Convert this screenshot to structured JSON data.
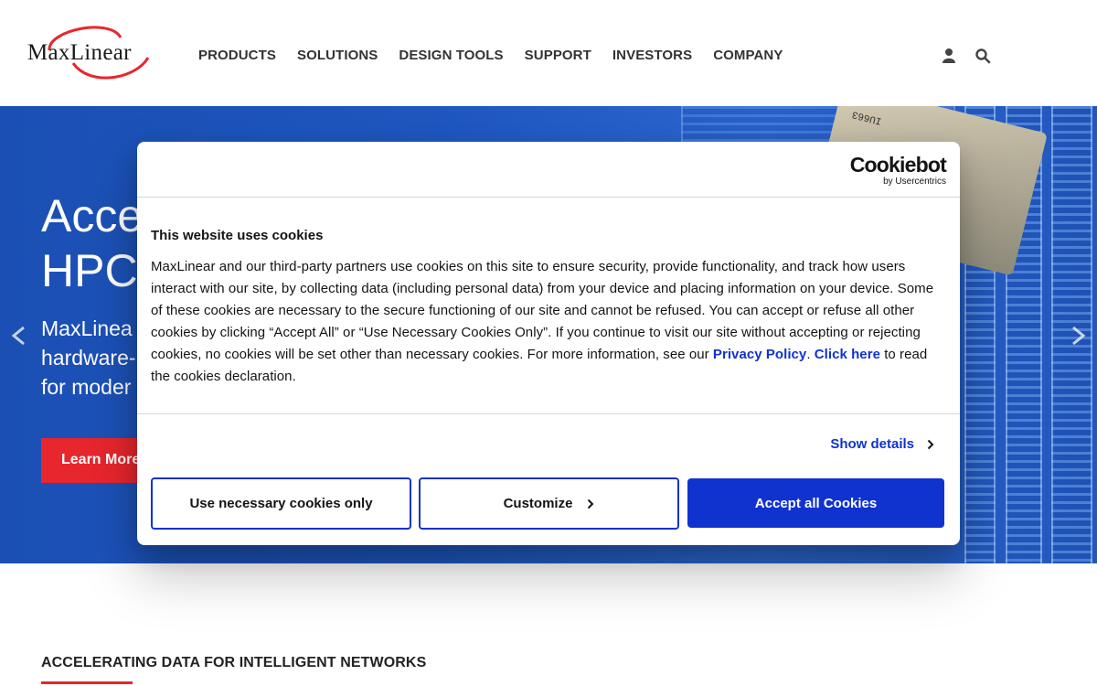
{
  "header": {
    "logo_text": "MaxLinear",
    "nav": [
      "PRODUCTS",
      "SOLUTIONS",
      "DESIGN TOOLS",
      "SUPPORT",
      "INVESTORS",
      "COMPANY"
    ],
    "icons": [
      "user-icon",
      "search-icon"
    ]
  },
  "hero": {
    "title_visible": "Acce\nHPC",
    "subtitle_visible": "MaxLinea\nhardware-\nfor moder",
    "button_visible": "Learn More",
    "chip_label": "IU663",
    "colors": {
      "background": "#1f57c0",
      "button": "#e8262d"
    }
  },
  "section": {
    "title": "ACCELERATING DATA FOR INTELLIGENT NETWORKS"
  },
  "cookie_dialog": {
    "brand": "Cookiebot",
    "brand_by": "by Usercentrics",
    "heading": "This website uses cookies",
    "body_text": "MaxLinear and our third-party partners use cookies on this site to ensure security, provide functionality, and track how users interact with our site, by collecting data (including personal data) from your device and placing information on your device. Some of these cookies are necessary to the secure functioning of our site and cannot be refused. You can accept or refuse all other cookies by clicking “Accept All” or “Use Necessary Cookies Only”.  If you continue to visit our site without accepting or rejecting cookies, no cookies will be set other than necessary cookies. For more information, see our ",
    "privacy_link": "Privacy Policy",
    "sep": ". ",
    "click_here_link": "Click here",
    "tail_text": " to read the cookies declaration.",
    "show_details": "Show details",
    "buttons": {
      "necessary": "Use necessary cookies only",
      "customize": "Customize",
      "accept": "Accept all Cookies"
    },
    "colors": {
      "accent": "#1032cf"
    }
  }
}
